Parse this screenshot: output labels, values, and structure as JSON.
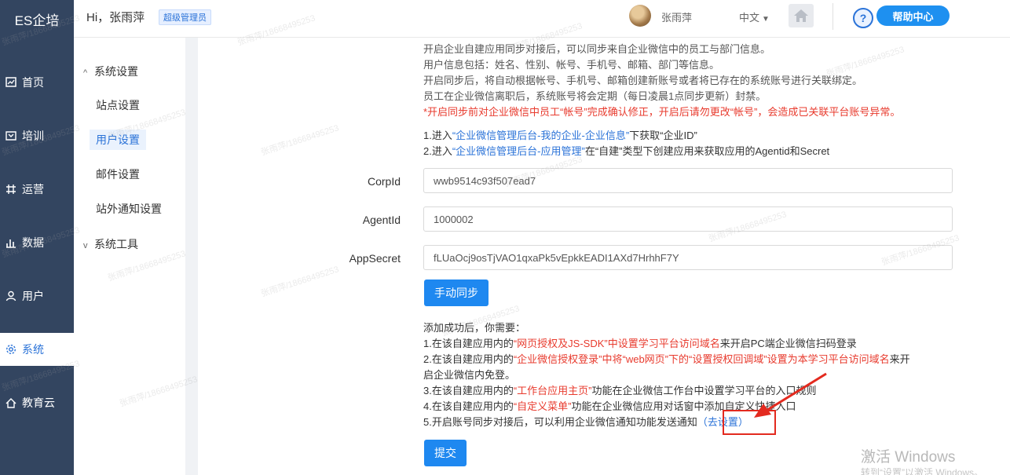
{
  "app": {
    "brand": "ES企培"
  },
  "header": {
    "greeting": "Hi，张雨萍",
    "role": "超级管理员",
    "username": "张雨萍",
    "language": "中文",
    "help_label": "帮助中心"
  },
  "nav": {
    "items": [
      {
        "label": "首页",
        "icon": "dashboard-icon"
      },
      {
        "label": "培训",
        "icon": "training-icon"
      },
      {
        "label": "运营",
        "icon": "operation-icon"
      },
      {
        "label": "数据",
        "icon": "chart-icon"
      },
      {
        "label": "用户",
        "icon": "user-icon"
      },
      {
        "label": "系统",
        "icon": "gear-icon",
        "active": true
      },
      {
        "label": "教育云",
        "icon": "cloud-icon"
      }
    ]
  },
  "subnav": {
    "group1": "系统设置",
    "items": [
      "站点设置",
      "用户设置",
      "邮件设置",
      "站外通知设置"
    ],
    "active": "用户设置",
    "group2": "系统工具"
  },
  "intro": {
    "line1": "开启企业自建应用同步对接后，可以同步来自企业微信中的员工与部门信息。",
    "line2": "用户信息包括：姓名、性别、帐号、手机号、邮箱、部门等信息。",
    "line3": "开启同步后，将自动根据帐号、手机号、邮箱创建新账号或者将已存在的系统账号进行关联绑定。",
    "line4": "员工在企业微信离职后，系统账号将会定期（每日凌晨1点同步更新）封禁。",
    "warning": "*开启同步前对企业微信中员工“帐号”完成确认修正，开启后请勿更改“帐号”，会造成已关联平台账号异常。"
  },
  "steps": {
    "s1_a": "1.进入",
    "s1_link": "“企业微信管理后台-我的企业-企业信息”",
    "s1_b": "下获取“企业ID”",
    "s2_a": "2.进入",
    "s2_link": "“企业微信管理后台-应用管理”",
    "s2_b": "在“自建”类型下创建应用来获取应用的Agentid和Secret"
  },
  "form": {
    "corpid_label": "CorpId",
    "corpid_value": "wwb9514c93f507ead7",
    "agentid_label": "AgentId",
    "agentid_value": "1000002",
    "appsecret_label": "AppSecret",
    "appsecret_value": "fLUaOcj9osTjVAO1qxaPk5vEpkkEADI1AXd7HrhhF7Y",
    "sync_button": "手动同步",
    "submit_button": "提交"
  },
  "after": {
    "title": "添加成功后，你需要：",
    "i1_a": "1.在该自建应用内的",
    "i1_r": "“网页授权及JS-SDK”中设置学习平台访问域名",
    "i1_b": "来开启PC端企业微信扫码登录",
    "i2_a": "2.在该自建应用内的",
    "i2_r1": "“企业微信授权登录”中将“web网页”下的“设置授权回调域”设置为本学习平台访问域名",
    "i2_b": "来开",
    "i2_c": "启企业微信内免登。",
    "i3_a": "3.在该自建应用内的",
    "i3_r": "“工作台应用主页”",
    "i3_b": "功能在企业微信工作台中设置学习平台的入口规则",
    "i4_a": "4.在该自建应用内的",
    "i4_r": "“自定义菜单”",
    "i4_b": "功能在企业微信应用对话窗中添加自定义快捷入口",
    "i5_a": "5.开启账号同步对接后，可以利用企业微信通知功能发送通知",
    "i5_link": "（去设置）"
  },
  "watermark": "张雨萍/18668495253",
  "windows": {
    "line1": "激活 Windows",
    "line2": "转到“设置”以激活 Windows。"
  },
  "colors": {
    "nav_bg": "#334560",
    "accent": "#1e88f0",
    "warning": "#e83b2e",
    "annotation": "#e32a1f"
  }
}
